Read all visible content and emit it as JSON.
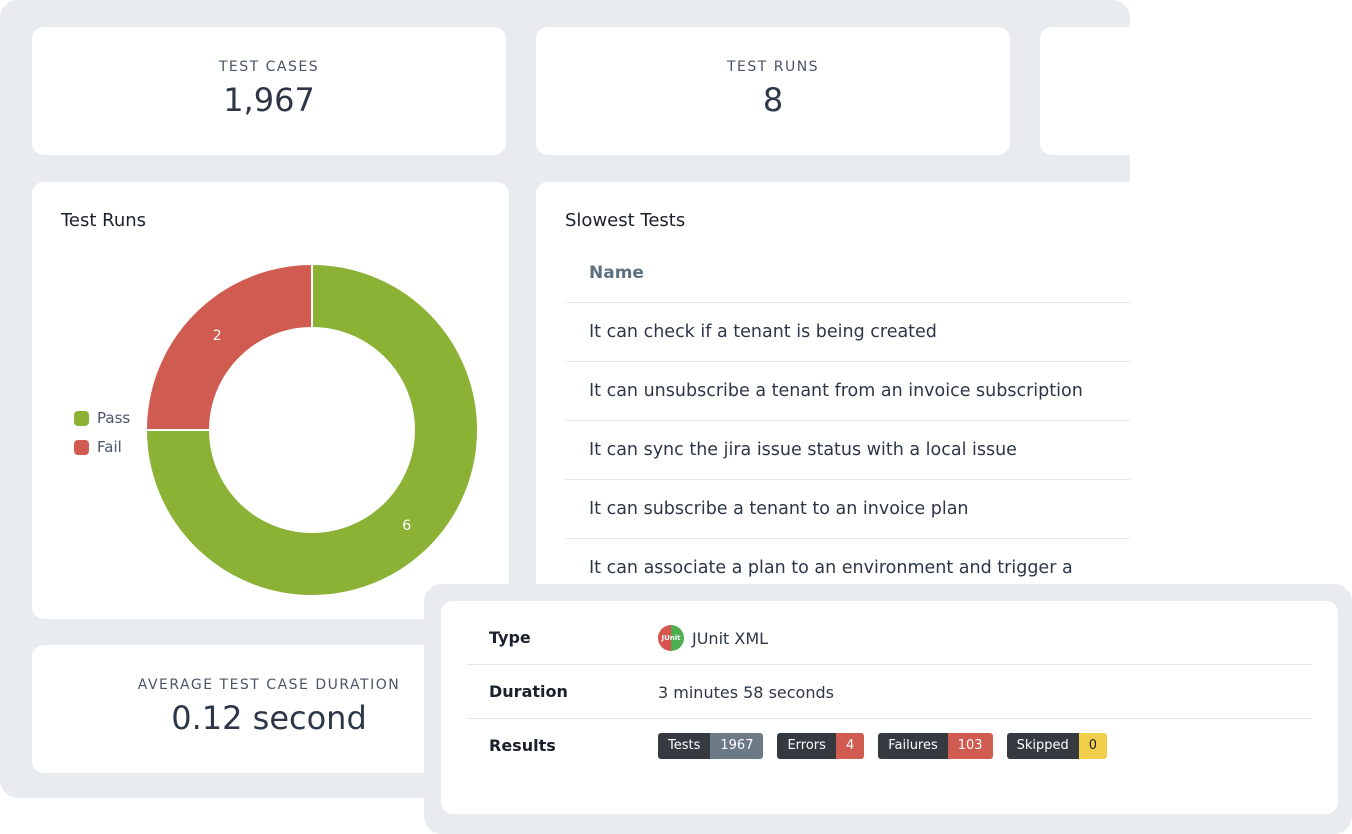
{
  "stats": {
    "test_cases": {
      "label": "TEST CASES",
      "value": "1,967"
    },
    "test_runs": {
      "label": "TEST RUNS",
      "value": "8"
    },
    "avg_duration": {
      "label": "AVERAGE TEST CASE DURATION",
      "value": "0.12 second"
    }
  },
  "test_runs_chart": {
    "title": "Test Runs",
    "legend": [
      {
        "label": "Pass",
        "color": "#8bb135"
      },
      {
        "label": "Fail",
        "color": "#d05b50"
      }
    ]
  },
  "chart_data": {
    "type": "pie",
    "title": "Test Runs",
    "categories": [
      "Pass",
      "Fail"
    ],
    "values": [
      6,
      2
    ],
    "colors": [
      "#8bb135",
      "#d05b50"
    ],
    "legend": "left"
  },
  "slowest_tests": {
    "title": "Slowest Tests",
    "column_header": "Name",
    "rows": [
      "It can check if a tenant is being created",
      "It can unsubscribe a tenant from an invoice subscription",
      "It can sync the jira issue status with a local issue",
      "It can subscribe a tenant to an invoice plan",
      "It can associate a plan to an environment and trigger a"
    ]
  },
  "details": {
    "type_label": "Type",
    "type_icon": "junit-icon",
    "type_icon_text": "JUnit",
    "type_value": "JUnit XML",
    "duration_label": "Duration",
    "duration_value": "3 minutes 58 seconds",
    "results_label": "Results",
    "badges": [
      {
        "label": "Tests",
        "value": "1967",
        "color": "#6c7a86"
      },
      {
        "label": "Errors",
        "value": "4",
        "color": "#d05b50"
      },
      {
        "label": "Failures",
        "value": "103",
        "color": "#d05b50"
      },
      {
        "label": "Skipped",
        "value": "0",
        "color": "#f2cf4a"
      }
    ]
  }
}
